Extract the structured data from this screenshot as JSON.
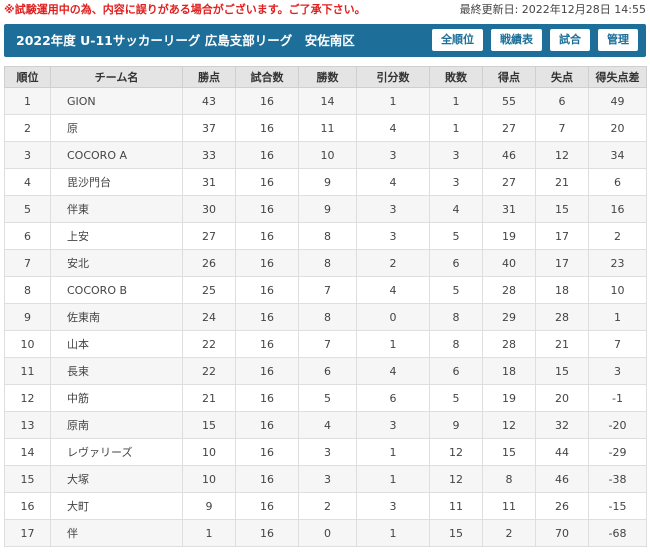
{
  "notice": "※試験運用中の為、内容に誤りがある場合がございます。ご了承下さい。",
  "updated": "最終更新日: 2022年12月28日 14:55",
  "header": {
    "title": "2022年度 U-11サッカーリーグ 広島支部リーグ　安佐南区",
    "buttons": {
      "standings": "全順位",
      "schedule": "戦績表",
      "match": "試合",
      "admin": "管理"
    }
  },
  "table": {
    "columns": [
      "順位",
      "チーム名",
      "勝点",
      "試合数",
      "勝数",
      "引分数",
      "敗数",
      "得点",
      "失点",
      "得失点差"
    ],
    "rows": [
      [
        "1",
        "GION",
        "43",
        "16",
        "14",
        "1",
        "1",
        "55",
        "6",
        "49"
      ],
      [
        "2",
        "原",
        "37",
        "16",
        "11",
        "4",
        "1",
        "27",
        "7",
        "20"
      ],
      [
        "3",
        "COCORO A",
        "33",
        "16",
        "10",
        "3",
        "3",
        "46",
        "12",
        "34"
      ],
      [
        "4",
        "毘沙門台",
        "31",
        "16",
        "9",
        "4",
        "3",
        "27",
        "21",
        "6"
      ],
      [
        "5",
        "伴東",
        "30",
        "16",
        "9",
        "3",
        "4",
        "31",
        "15",
        "16"
      ],
      [
        "6",
        "上安",
        "27",
        "16",
        "8",
        "3",
        "5",
        "19",
        "17",
        "2"
      ],
      [
        "7",
        "安北",
        "26",
        "16",
        "8",
        "2",
        "6",
        "40",
        "17",
        "23"
      ],
      [
        "8",
        "COCORO B",
        "25",
        "16",
        "7",
        "4",
        "5",
        "28",
        "18",
        "10"
      ],
      [
        "9",
        "佐東南",
        "24",
        "16",
        "8",
        "0",
        "8",
        "29",
        "28",
        "1"
      ],
      [
        "10",
        "山本",
        "22",
        "16",
        "7",
        "1",
        "8",
        "28",
        "21",
        "7"
      ],
      [
        "11",
        "長束",
        "22",
        "16",
        "6",
        "4",
        "6",
        "18",
        "15",
        "3"
      ],
      [
        "12",
        "中筋",
        "21",
        "16",
        "5",
        "6",
        "5",
        "19",
        "20",
        "-1"
      ],
      [
        "13",
        "原南",
        "15",
        "16",
        "4",
        "3",
        "9",
        "12",
        "32",
        "-20"
      ],
      [
        "14",
        "レヴァリーズ",
        "10",
        "16",
        "3",
        "1",
        "12",
        "15",
        "44",
        "-29"
      ],
      [
        "15",
        "大塚",
        "10",
        "16",
        "3",
        "1",
        "12",
        "8",
        "46",
        "-38"
      ],
      [
        "16",
        "大町",
        "9",
        "16",
        "2",
        "3",
        "11",
        "11",
        "26",
        "-15"
      ],
      [
        "17",
        "伴",
        "1",
        "16",
        "0",
        "1",
        "15",
        "2",
        "70",
        "-68"
      ]
    ]
  }
}
